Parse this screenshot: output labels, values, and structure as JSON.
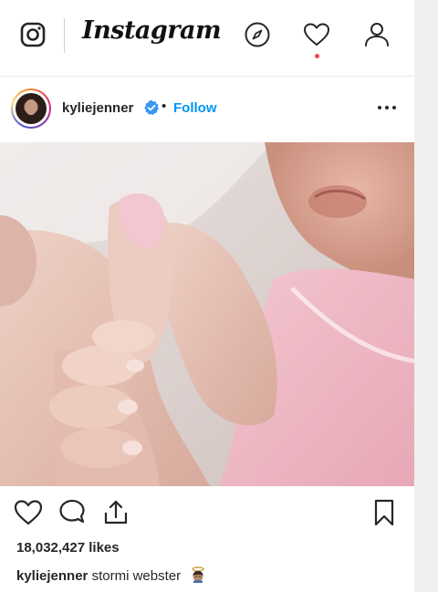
{
  "header": {
    "wordmark": "Instagram",
    "icons": [
      "instagram-glyph-icon",
      "compass-icon",
      "heart-icon",
      "person-icon"
    ],
    "notification_dot_color": "#ed4956"
  },
  "post": {
    "username": "kyliejenner",
    "verified_icon": "verified-badge-icon",
    "separator": "•",
    "follow_label": "Follow",
    "more_icon": "more-options-icon",
    "photo": "newborn hand holding adult thumb",
    "likes": "18,032,427 likes",
    "caption": {
      "username": "kyliejenner",
      "text": "stormi webster",
      "emoji": "angel-emoji"
    }
  },
  "actions": [
    "heart-icon",
    "comment-icon",
    "share-icon",
    "bookmark-icon"
  ],
  "colors": {
    "accent": "#0095f6",
    "text": "#262626",
    "verified": "#3897f0"
  }
}
